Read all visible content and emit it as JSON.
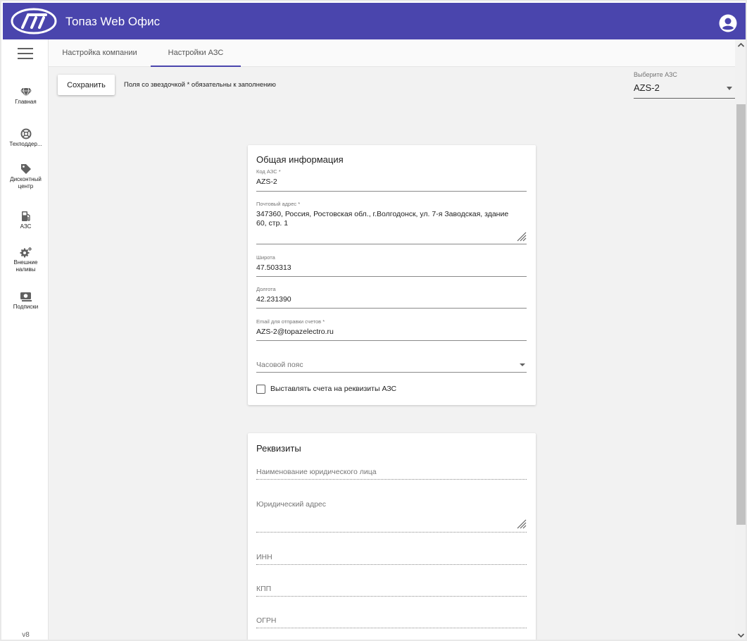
{
  "app": {
    "title": "Топаз Web Офис"
  },
  "sidebar": {
    "items": [
      {
        "label": "Главная",
        "icon": "diamond-icon"
      },
      {
        "label": "Техподдер...",
        "icon": "lifebuoy-icon"
      },
      {
        "label": "Дисконтный центр",
        "icon": "tag-icon"
      },
      {
        "label": "АЗС",
        "icon": "fuel-pump-icon"
      },
      {
        "label": "Внешние наливы",
        "icon": "gears-icon"
      },
      {
        "label": "Подписки",
        "icon": "subscription-icon"
      }
    ],
    "version": "v8"
  },
  "tabs": [
    {
      "label": "Настройка компании",
      "active": false
    },
    {
      "label": "Настройки АЗС",
      "active": true
    }
  ],
  "toolbar": {
    "save_label": "Сохранить",
    "required_note": "Поля со звездочкой * обязательны к заполнению",
    "station_select": {
      "label": "Выберите АЗС",
      "value": "AZS-2"
    }
  },
  "general": {
    "title": "Общая информация",
    "code": {
      "label": "Код АЗС *",
      "value": "AZS-2"
    },
    "address": {
      "label": "Почтовый адрес *",
      "line1": "347360, Россия, Ростовская обл., г.Волгодонск, ул. 7-я Заводская, здание",
      "line2": "60, стр. 1"
    },
    "latitude": {
      "label": "Широта",
      "value": "47.503313"
    },
    "longitude": {
      "label": "Долгота",
      "value": "42.231390"
    },
    "email": {
      "label": "Email для отправки счетов *",
      "value": "AZS-2@topazelectro.ru"
    },
    "timezone": {
      "placeholder": "Часовой пояс"
    },
    "invoice_checkbox": {
      "label": "Выставлять счета на реквизиты АЗС",
      "checked": false
    }
  },
  "requisites": {
    "title": "Реквизиты",
    "fields": [
      "Наименование юридического лица",
      "Юридический адрес",
      "ИНН",
      "КПП",
      "ОГРН"
    ]
  },
  "colors": {
    "primary": "#4a45ad",
    "background": "#f2f2f2"
  }
}
